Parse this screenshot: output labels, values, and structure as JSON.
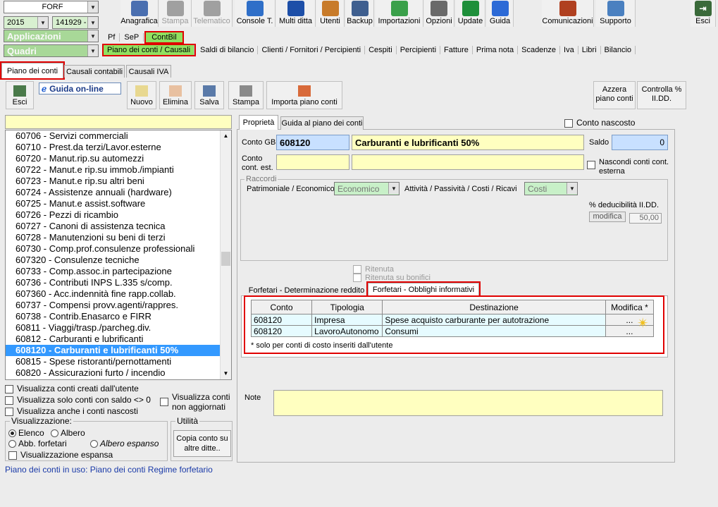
{
  "top_left": {
    "user": "FORF",
    "year": "2015",
    "code": "141929 -",
    "applicazioni": "Applicazioni",
    "quadri": "Quadri"
  },
  "toolbar": [
    {
      "label": "Anagrafica",
      "icon": "id-card-icon",
      "color": "#4a6fb0",
      "disabled": false
    },
    {
      "label": "Stampa",
      "icon": "printer-icon",
      "color": "#a0a0a0",
      "disabled": true
    },
    {
      "label": "Telematico",
      "icon": "edit-icon",
      "color": "#a0a0a0",
      "disabled": true
    },
    {
      "label": "Console T.",
      "icon": "monitor-icon",
      "color": "#2f6fc8",
      "disabled": false
    },
    {
      "label": "Multi ditta",
      "icon": "m-icon",
      "color": "#1d4fa8",
      "disabled": false
    },
    {
      "label": "Utenti",
      "icon": "users-icon",
      "color": "#c87b2a",
      "disabled": false
    },
    {
      "label": "Backup",
      "icon": "database-icon",
      "color": "#3f5f8f",
      "disabled": false
    },
    {
      "label": "Importazioni",
      "icon": "download-icon",
      "color": "#3aa04a",
      "disabled": false
    },
    {
      "label": "Opzioni",
      "icon": "wrench-icon",
      "color": "#6a6a6a",
      "disabled": false
    },
    {
      "label": "Update",
      "icon": "pulse-monitor-icon",
      "color": "#1e8f3a",
      "disabled": false
    },
    {
      "label": "Guida",
      "icon": "help-icon",
      "color": "#2c6ad6",
      "disabled": false
    }
  ],
  "toolbar_right": [
    {
      "label": "Comunicazioni",
      "icon": "people-icon",
      "color": "#b04020"
    },
    {
      "label": "Supporto",
      "icon": "support-icon",
      "color": "#4a80c0"
    }
  ],
  "esci_top": "Esci",
  "menu_row1": {
    "pf": "Pf",
    "sep": "SeP",
    "contbil": "ContBil"
  },
  "menu_row2": [
    "Piano dei conti / Causali",
    "Saldi di bilancio",
    "Clienti / Fornitori / Percipienti",
    "Cespiti",
    "Percipienti",
    "Fatture",
    "Prima nota",
    "Scadenze",
    "Iva",
    "Libri",
    "Bilancio"
  ],
  "subtabs": [
    "Piano dei conti",
    "Causali contabili",
    "Causali IVA"
  ],
  "btns": {
    "esci": "Esci",
    "guida": "Guida on-line",
    "nuovo": "Nuovo",
    "elimina": "Elimina",
    "salva": "Salva",
    "stampa": "Stampa",
    "importa": "Importa piano conti",
    "azzera1": "Azzera",
    "azzera2": "piano conti",
    "controlla1": "Controlla %",
    "controlla2": "II.DD."
  },
  "accounts": [
    "60706 - Servizi commerciali",
    "60710 - Prest.da terzi/Lavor.esterne",
    "60720 - Manut.rip.su automezzi",
    "60722 - Manut.e rip.su immob./impianti",
    "60723 - Manut.e rip.su altri beni",
    "60724 - Assistenze annuali (hardware)",
    "60725 - Manut.e assist.software",
    "60726 - Pezzi di ricambio",
    "60727 - Canoni di assistenza tecnica",
    "60728 - Manutenzioni su beni di terzi",
    "60730 - Comp.prof.consulenze professionali",
    "607320 - Consulenze tecniche",
    "60733 - Comp.assoc.in partecipazione",
    "60736 - Contributi INPS L.335 s/comp.",
    "607360 - Acc.indennità fine rapp.collab.",
    "60737 - Compensi provv.agenti/rappres.",
    "60738 - Contrib.Enasarco e FIRR",
    "60811 - Viaggi/trasp./parcheg.div.",
    "60812 - Carburanti e lubrificanti",
    "608120 - Carburanti e lubrificanti 50%",
    "60815 - Spese ristoranti/pernottamenti",
    "60820 - Assicurazioni furto / incendio"
  ],
  "selected_index": 19,
  "options": {
    "creati": "Visualizza conti creati dall'utente",
    "saldo": "Visualizza solo conti con saldo <> 0",
    "nascosti": "Visualizza anche i conti nascosti",
    "non_agg1": "Visualizza conti",
    "non_agg2": "non aggiornati"
  },
  "visualizzazione": {
    "title": "Visualizzazione:",
    "elenco": "Elenco",
    "albero": "Albero",
    "abb": "Abb. forfetari",
    "albero_esp": "Albero espanso",
    "espansa": "Visualizzazione espansa"
  },
  "utilita": {
    "title": "Utilità",
    "copia1": "Copia conto su",
    "copia2": "altre ditte.."
  },
  "footer": "Piano dei conti in uso: Piano dei conti Regime forfetario",
  "right_tabs": [
    "Proprietà",
    "Guida al piano dei conti"
  ],
  "conto_nascosto": "Conto nascosto",
  "form": {
    "conto_gb_label": "Conto GB",
    "conto_gb": "608120",
    "descr": "Carburanti e lubrificanti 50%",
    "saldo_label": "Saldo",
    "saldo": "0",
    "conto_est1": "Conto",
    "conto_est2": "cont. est.",
    "nascondi1": "Nascondi conti cont.",
    "nascondi2": "esterna"
  },
  "raccordi": {
    "title": "Raccordi",
    "pat_label": "Patrimoniale / Economico",
    "pat": "Economico",
    "att_label": "Attività / Passività / Costi / Ricavi",
    "att": "Costi",
    "ded_label": "% deducibilità II.DD.",
    "modifica": "modifica",
    "ded": "50,00"
  },
  "ritenuta": "Ritenuta",
  "ritenuta_bonifici": "Ritenuta su bonifici",
  "lower_tabs": [
    "Forfetari - Determinazione reddito",
    "Forfetari - Obblighi informativi"
  ],
  "grid": {
    "headers": [
      "Conto",
      "Tipologia",
      "Destinazione",
      "Modifica *"
    ],
    "rows": [
      [
        "608120",
        "Impresa",
        "Spese acquisto carburante per autotrazione",
        "..."
      ],
      [
        "608120",
        "LavoroAutonomo",
        "Consumi",
        "..."
      ]
    ],
    "note": "* solo per conti di costo inseriti dall'utente"
  },
  "note_label": "Note",
  "colors": {
    "highlight": "#e00000",
    "selection": "#3399ff",
    "field_yellow": "#ffffc0",
    "field_blue": "#c8e0ff",
    "field_green": "#c8f0c8"
  }
}
